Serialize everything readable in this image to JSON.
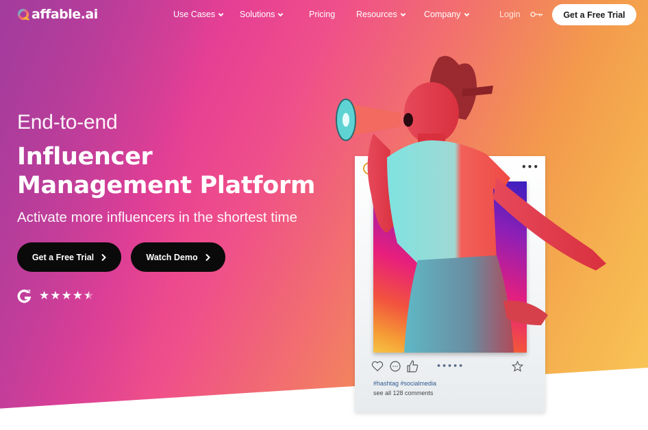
{
  "brand": {
    "name": "affable.ai",
    "colors": {
      "gradient_start": "#a63c9a",
      "gradient_mid": "#ef4f8a",
      "gradient_end": "#f9c85a",
      "button_dark": "#0a0a0a",
      "hashtag_blue": "#2f5a8f"
    }
  },
  "nav": {
    "items": [
      {
        "label": "Use Cases",
        "has_dropdown": true
      },
      {
        "label": "Solutions",
        "has_dropdown": true
      },
      {
        "label": "Pricing",
        "has_dropdown": false
      },
      {
        "label": "Resources",
        "has_dropdown": true
      },
      {
        "label": "Company",
        "has_dropdown": true
      }
    ],
    "login_label": "Login",
    "login_icon": "key-icon",
    "cta_label": "Get a Free Trial"
  },
  "hero": {
    "eyebrow": "End-to-end",
    "headline_line1": "Influencer",
    "headline_line2": "Management Platform",
    "subheadline": "Activate more influencers in the shortest time",
    "primary_button": "Get a Free Trial",
    "secondary_button": "Watch Demo",
    "rating": {
      "provider_icon": "g2-logo-icon",
      "stars": 4.5,
      "max_stars": 5
    }
  },
  "post_card": {
    "more_icon": "•••",
    "pagination_dots": "•••••",
    "hashtags": "#hashtag #socialmedia",
    "comments_link": "see all 128 comments"
  }
}
